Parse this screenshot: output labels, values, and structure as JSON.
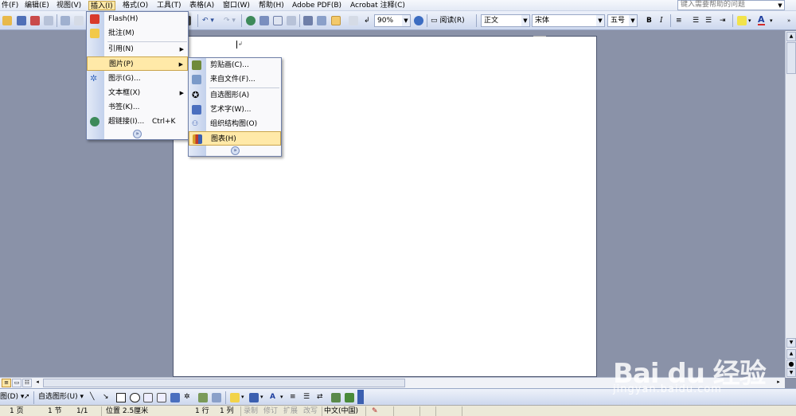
{
  "menubar": {
    "items": [
      {
        "label": "件(F)"
      },
      {
        "label": "编辑(E)"
      },
      {
        "label": "视图(V)"
      },
      {
        "label": "插入(I)"
      },
      {
        "label": "格式(O)"
      },
      {
        "label": "工具(T)"
      },
      {
        "label": "表格(A)"
      },
      {
        "label": "窗口(W)"
      },
      {
        "label": "帮助(H)"
      },
      {
        "label": "Adobe PDF(B)"
      },
      {
        "label": "Acrobat 注释(C)"
      }
    ],
    "help_placeholder": "键入需要帮助的问题"
  },
  "toolbar": {
    "zoom": "90%",
    "read_label": "阅读(R)",
    "style": "正文",
    "font": "宋体",
    "size": "五号",
    "bold": "B",
    "italic": "I",
    "font_color_glyph": "A"
  },
  "insert_menu": {
    "items": [
      {
        "label": "Flash(H)",
        "shortcut": "",
        "icon": "flash-icon"
      },
      {
        "label": "批注(M)",
        "shortcut": "",
        "icon": "comment-icon"
      },
      {
        "label": "引用(N)",
        "shortcut": "",
        "icon": ""
      },
      {
        "label": "图片(P)",
        "shortcut": "",
        "icon": ""
      },
      {
        "label": "图示(G)...",
        "shortcut": "",
        "icon": "diagram-icon"
      },
      {
        "label": "文本框(X)",
        "shortcut": "",
        "icon": ""
      },
      {
        "label": "书签(K)...",
        "shortcut": "",
        "icon": ""
      },
      {
        "label": "超链接(I)...",
        "shortcut": "Ctrl+K",
        "icon": "hyperlink-icon"
      }
    ]
  },
  "picture_menu": {
    "items": [
      {
        "label": "剪贴画(C)...",
        "icon": "clipart-icon"
      },
      {
        "label": "来自文件(F)...",
        "icon": "from-file-icon"
      },
      {
        "label": "自选图形(A)",
        "icon": "autoshape-icon"
      },
      {
        "label": "艺术字(W)...",
        "icon": "wordart-icon"
      },
      {
        "label": "组织结构图(O)",
        "icon": "org-chart-icon"
      },
      {
        "label": "图表(H)",
        "icon": "chart-icon"
      }
    ]
  },
  "drawbar": {
    "draw_label": "图(D)",
    "autoshapes_label": "自选图形(U)"
  },
  "statusbar": {
    "page": "1 页",
    "section": "1 节",
    "pages": "1/1",
    "position": "位置 2.5厘米",
    "line": "1 行",
    "column": "1 列",
    "rec": "录制",
    "trk": "修订",
    "ext": "扩展",
    "ovr": "改写",
    "language": "中文(中国)"
  },
  "watermark": {
    "logo": "Bai du 经验",
    "url": "jingyan.baidu.com"
  }
}
